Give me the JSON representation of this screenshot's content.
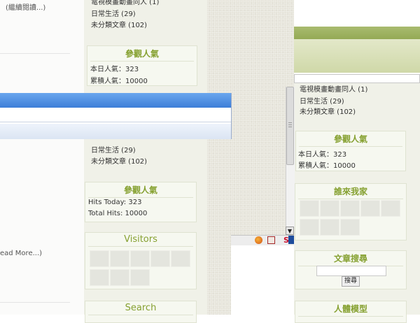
{
  "left": {
    "read_more_top": "(繼續閱讀...)",
    "read_more_bottom": "ead More...)",
    "cats_top": [
      "日常生活 (29)",
      "未分類文章 (102)"
    ],
    "cats_mid": [
      "日常生活 (29)",
      "未分類文章 (102)"
    ],
    "popularity_title": "參觀人氣",
    "pop_today": "本日人氣：323",
    "pop_total": "累積人氣：10000",
    "hits_title": "參觀人氣",
    "hits_today": "Hits Today: 323",
    "hits_total": "Total Hits: 10000",
    "visitors_title": "Visitors",
    "search_title": "Search"
  },
  "right": {
    "cats": [
      "日常生活 (29)",
      "未分類文章 (102)"
    ],
    "popularity_title": "參觀人氣",
    "pop_today": "本日人氣：323",
    "pop_total": "累積人氣：10000",
    "visitors_title": "誰來我家",
    "search_title": "文章搜尋",
    "search_button": "搜尋",
    "model_title": "人體模型"
  },
  "status_icons": [
    "firefox-icon",
    "screen-icon",
    "s-icon"
  ],
  "colors": {
    "accent": "#86a131",
    "panel": "#f6f8f0",
    "dialog_header": "#4a90e2"
  }
}
